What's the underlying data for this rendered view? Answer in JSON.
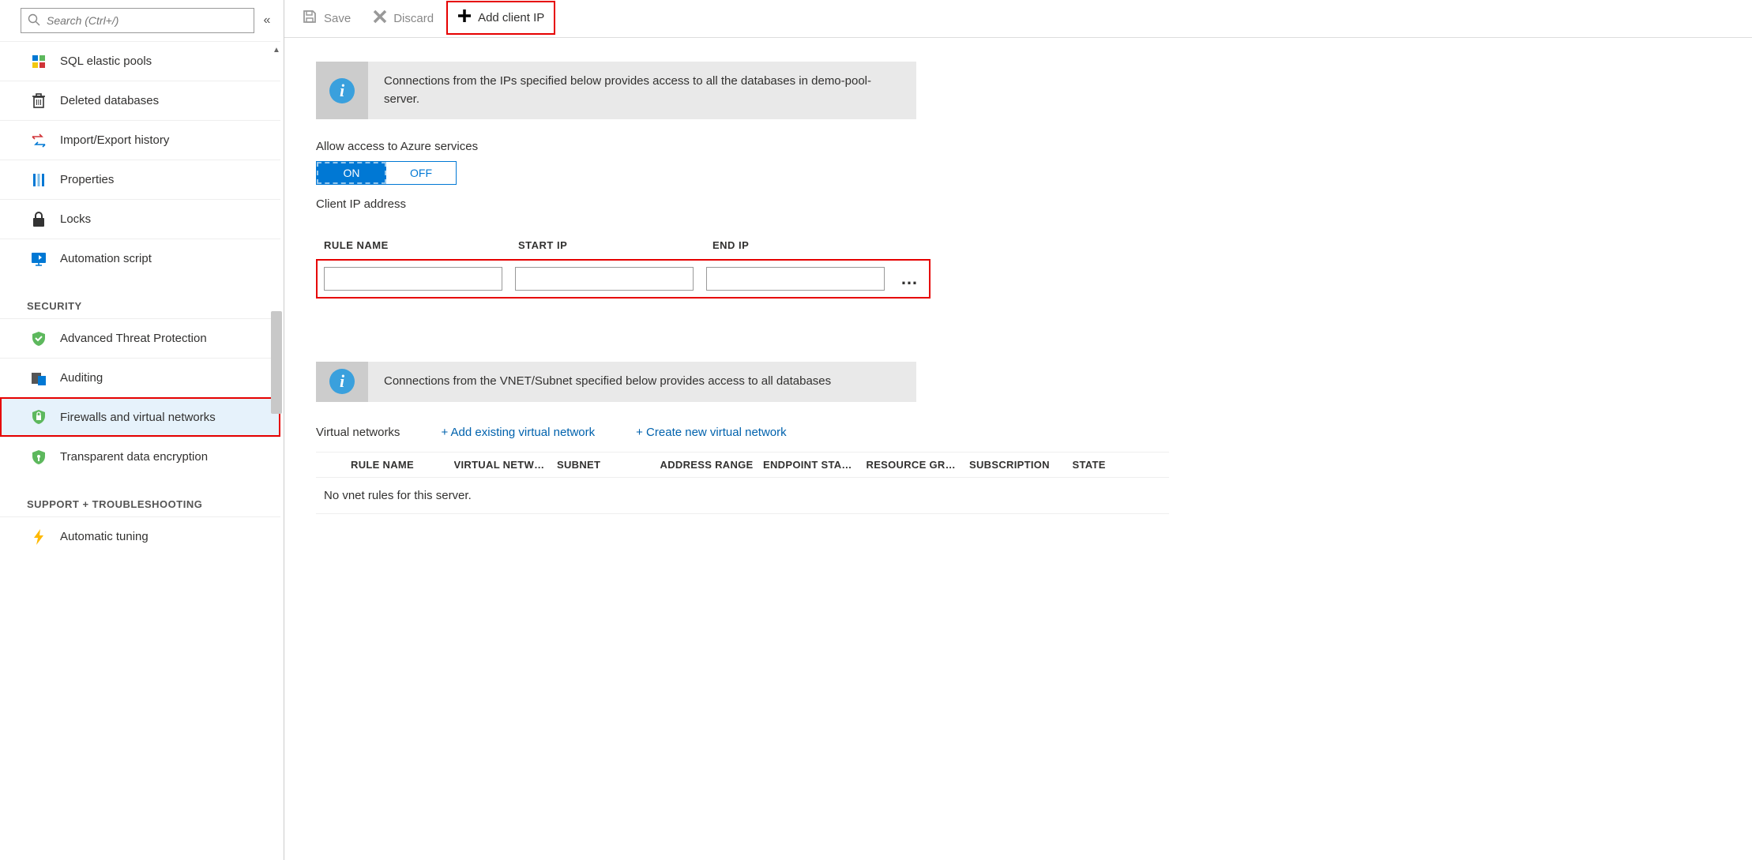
{
  "search": {
    "placeholder": "Search (Ctrl+/)"
  },
  "sidebar": {
    "items": [
      {
        "label": "SQL elastic pools"
      },
      {
        "label": "Deleted databases"
      },
      {
        "label": "Import/Export history"
      },
      {
        "label": "Properties"
      },
      {
        "label": "Locks"
      },
      {
        "label": "Automation script"
      }
    ],
    "section_security": "SECURITY",
    "security_items": [
      {
        "label": "Advanced Threat Protection"
      },
      {
        "label": "Auditing"
      },
      {
        "label": "Firewalls and virtual networks",
        "selected": true
      },
      {
        "label": "Transparent data encryption"
      }
    ],
    "section_support": "SUPPORT + TROUBLESHOOTING",
    "support_items": [
      {
        "label": "Automatic tuning"
      }
    ]
  },
  "toolbar": {
    "save": "Save",
    "discard": "Discard",
    "add_client_ip": "Add client IP"
  },
  "info1": "Connections from the IPs specified below provides access to all the databases in demo-pool-server.",
  "allow_label": "Allow access to Azure services",
  "toggle": {
    "on": "ON",
    "off": "OFF"
  },
  "client_ip_label": "Client IP address",
  "fw_headers": {
    "rule": "RULE NAME",
    "start": "START IP",
    "end": "END IP"
  },
  "fw_values": {
    "rule": "",
    "start": "",
    "end": ""
  },
  "info2": "Connections from the VNET/Subnet specified below provides access to all databases",
  "vnet": {
    "title": "Virtual networks",
    "add_existing": "+ Add existing virtual network",
    "create_new": "+ Create new virtual network",
    "cols": {
      "rule": "RULE NAME",
      "vnet": "VIRTUAL NETW…",
      "subnet": "SUBNET",
      "range": "ADDRESS RANGE",
      "endpoint": "ENDPOINT STA…",
      "rg": "RESOURCE GROUP",
      "sub": "SUBSCRIPTION",
      "state": "STATE"
    },
    "empty": "No vnet rules for this server."
  }
}
